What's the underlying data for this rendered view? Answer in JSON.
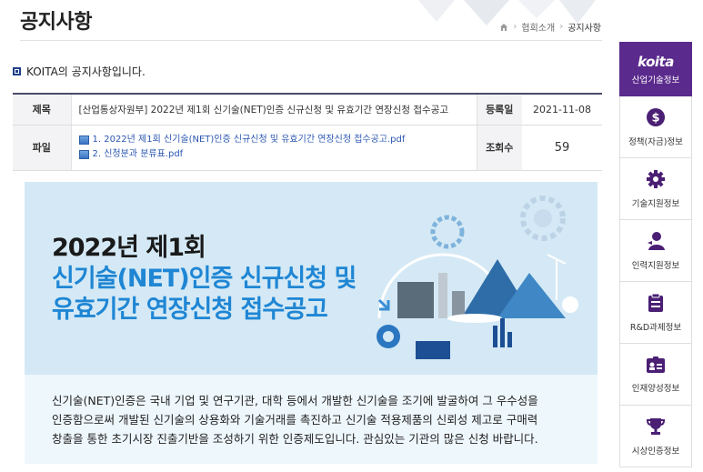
{
  "page": {
    "title": "공지사항",
    "breadcrumb": [
      "협회소개",
      "공지사항"
    ],
    "intro": "KOITA의 공지사항입니다."
  },
  "notice": {
    "subject_label": "제목",
    "subject": "[산업통상자원부] 2022년 제1회 신기술(NET)인증 신규신청 및 유효기간 연장신청 접수공고",
    "date_label": "등록일",
    "date": "2021-11-08",
    "file_label": "파일",
    "files": [
      "1. 2022년 제1회 신기술(NET)인증 신규신청 및 유효기간 연장신청 접수공고.pdf",
      "2. 신청분과 분류표.pdf"
    ],
    "views_label": "조회수",
    "views": "59"
  },
  "banner": {
    "line1": "2022년 제1회",
    "line2": "신기술(NET)인증 신규신청 및",
    "line3": "유효기간 연장신청 접수공고",
    "desc1": "신기술(NET)인증은 국내 기업 및 연구기관, 대학 등에서 개발한 신기술을 조기에 발굴하여 그 우수성을",
    "desc2": "인증함으로써 개발된 신기술의 상용화와 기술거래를 촉진하고 신기술 적용제품의 신뢰성 제고로 구매력",
    "desc3": "창출을 통한 초기시장 진출기반을 조성하기 위한 인증제도입니다. 관심있는 기관의 많은 신청 바랍니다."
  },
  "sidebar": {
    "logo": "koita",
    "subtitle": "산업기술정보",
    "items": [
      {
        "label": "정책(자금)정보",
        "icon": "dollar-icon"
      },
      {
        "label": "기술지원정보",
        "icon": "gear-icon"
      },
      {
        "label": "인력지원정보",
        "icon": "person-icon"
      },
      {
        "label": "R&D과제정보",
        "icon": "clipboard-icon"
      },
      {
        "label": "인재양성정보",
        "icon": "id-card-icon"
      },
      {
        "label": "시상인증정보",
        "icon": "trophy-icon"
      }
    ]
  },
  "colors": {
    "sidebar_accent": "#5a2a8c",
    "banner_bg": "#d4e9f5",
    "title_blue": "#1f86d4",
    "link_blue": "#2b57b2"
  }
}
